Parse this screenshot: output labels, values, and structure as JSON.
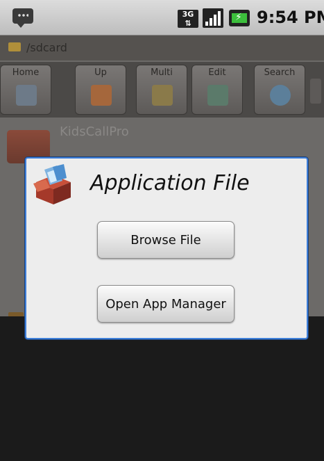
{
  "status_bar": {
    "network": "3G",
    "time": "9:54 PM",
    "colors": {
      "bar": "#cfcfcf",
      "battery": "#3cbf3c"
    }
  },
  "background_app": {
    "path": "/sdcard",
    "toolbar": [
      {
        "label": "Home",
        "icon": "home-icon"
      },
      {
        "label": "Up",
        "icon": "up-folder-icon"
      },
      {
        "label": "Multi",
        "icon": "multi-select-icon"
      },
      {
        "label": "Edit",
        "icon": "edit-icon"
      },
      {
        "label": "Search",
        "icon": "search-icon"
      }
    ],
    "file": {
      "name": "KidsCallPro",
      "icon": "folder-icon"
    }
  },
  "dialog": {
    "title": "Application File",
    "icon": "package-box-icon",
    "buttons": {
      "browse": "Browse File",
      "manager": "Open App Manager"
    },
    "colors": {
      "border": "#3d7ed9",
      "background": "#ededed"
    }
  }
}
